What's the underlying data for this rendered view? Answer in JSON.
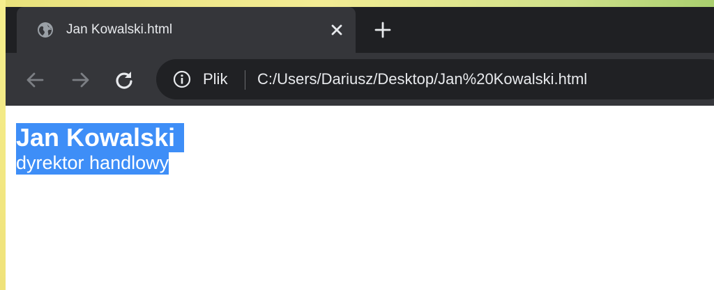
{
  "browser": {
    "tab": {
      "title": "Jan Kowalski.html",
      "favicon": "globe-icon",
      "close_icon": "close-icon"
    },
    "new_tab_icon": "plus-icon",
    "nav": {
      "back_icon": "arrow-left-icon",
      "forward_icon": "arrow-right-icon",
      "reload_icon": "reload-icon"
    },
    "omnibox": {
      "info_icon": "info-icon",
      "scheme_label": "Plik",
      "url": "C:/Users/Dariusz/Desktop/Jan%20Kowalski.html"
    }
  },
  "page": {
    "name": "Jan Kowalski",
    "role": "dyrektor handlowy"
  },
  "colors": {
    "tabstrip": "#1f2023",
    "toolbar": "#35363a",
    "omnibox": "#202124",
    "selection": "#3e8ef7"
  }
}
